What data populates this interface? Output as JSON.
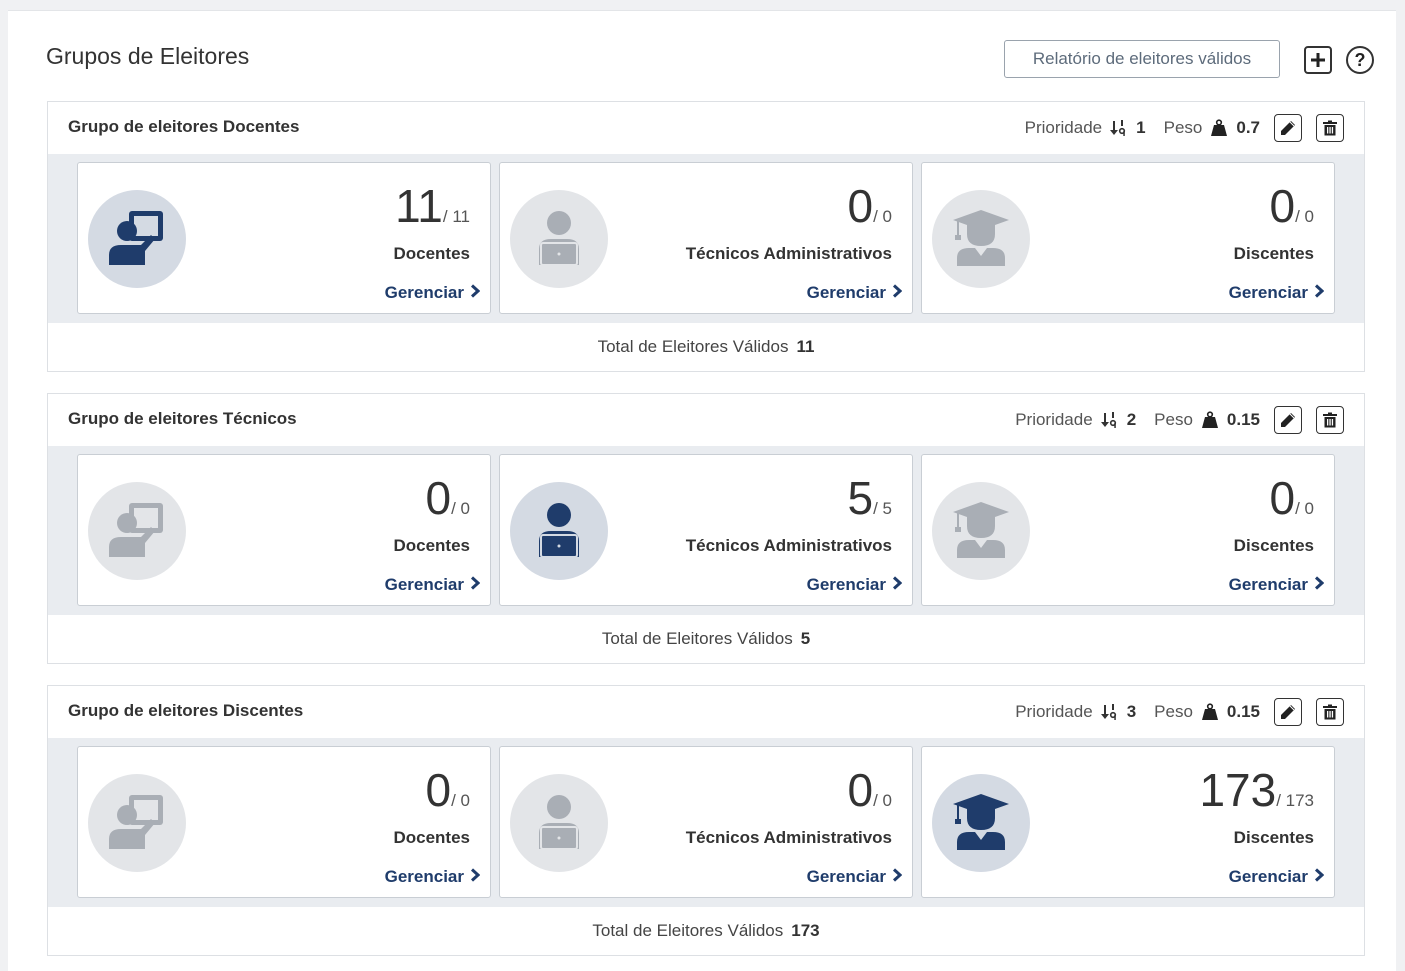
{
  "page": {
    "title": "Grupos de Eleitores"
  },
  "toolbar": {
    "report_label": "Relatório de eleitores válidos",
    "add_icon": "plus-icon",
    "help_icon": "help-icon"
  },
  "labels": {
    "priority": "Prioridade",
    "weight": "Peso",
    "manage": "Gerenciar",
    "total": "Total de Eleitores Válidos"
  },
  "colors": {
    "active_icon": "#1f3c6b",
    "inactive_icon": "#a9aeb5",
    "link": "#1f3c6b"
  },
  "groups": [
    {
      "title": "Grupo de eleitores Docentes",
      "priority": "1",
      "weight": "0.7",
      "total": "11",
      "cards": [
        {
          "count": "11",
          "of": "/ 11",
          "label": "Docentes",
          "icon": "teacher-icon",
          "active": true
        },
        {
          "count": "0",
          "of": "/ 0",
          "label": "Técnicos Administrativos",
          "icon": "staff-laptop-icon",
          "active": false
        },
        {
          "count": "0",
          "of": "/ 0",
          "label": "Discentes",
          "icon": "graduate-icon",
          "active": false
        }
      ]
    },
    {
      "title": "Grupo de eleitores Técnicos",
      "priority": "2",
      "weight": "0.15",
      "total": "5",
      "cards": [
        {
          "count": "0",
          "of": "/ 0",
          "label": "Docentes",
          "icon": "teacher-icon",
          "active": false
        },
        {
          "count": "5",
          "of": "/ 5",
          "label": "Técnicos Administrativos",
          "icon": "staff-laptop-icon",
          "active": true
        },
        {
          "count": "0",
          "of": "/ 0",
          "label": "Discentes",
          "icon": "graduate-icon",
          "active": false
        }
      ]
    },
    {
      "title": "Grupo de eleitores Discentes",
      "priority": "3",
      "weight": "0.15",
      "total": "173",
      "cards": [
        {
          "count": "0",
          "of": "/ 0",
          "label": "Docentes",
          "icon": "teacher-icon",
          "active": false
        },
        {
          "count": "0",
          "of": "/ 0",
          "label": "Técnicos Administrativos",
          "icon": "staff-laptop-icon",
          "active": false
        },
        {
          "count": "173",
          "of": "/ 173",
          "label": "Discentes",
          "icon": "graduate-icon",
          "active": true
        }
      ]
    }
  ]
}
